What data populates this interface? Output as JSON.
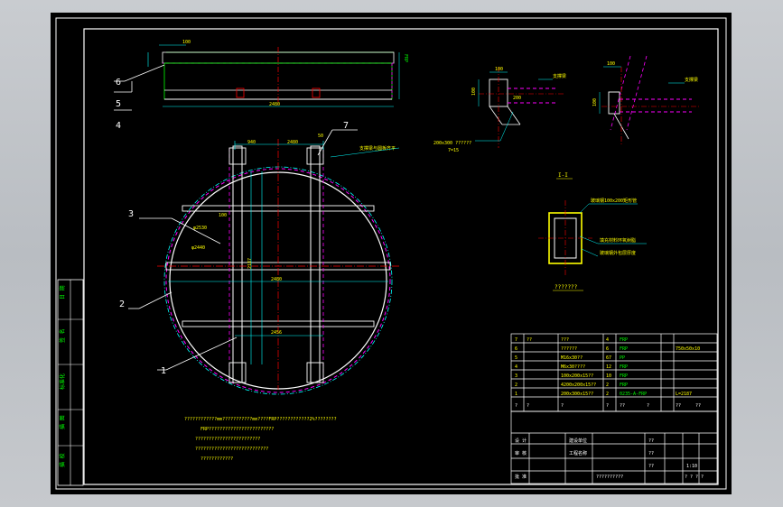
{
  "colors": {
    "background": "#000000",
    "frame": "#ffffff",
    "line": "#00ff00",
    "dim": "#00ffff",
    "hidden": "#ff00ff",
    "text_yellow": "#ffff00",
    "center": "#ff0000"
  },
  "top_view": {
    "dims": {
      "top": "100",
      "bottom": "2480"
    },
    "callouts": [
      "6",
      "5",
      "4"
    ]
  },
  "main_view": {
    "callouts": [
      "3",
      "2",
      "1",
      "7"
    ],
    "dims": {
      "top_a": "940",
      "top_b": "2480",
      "top_c": "50",
      "mid": "100",
      "center_v": "2187",
      "center_h": "2480",
      "lower": "2456"
    },
    "ring_labels": [
      "φ2530",
      "φ2440"
    ],
    "note_7": "支撑梁与圆板齐平"
  },
  "detail_a": {
    "label_main": "支撑梁",
    "dims": {
      "w": "100",
      "h": "100",
      "d": "200"
    },
    "note1": "200x300 ??????",
    "note2": "7=15"
  },
  "detail_b": {
    "label_main": "支撑梁",
    "dims": {
      "w": "100",
      "h": "100"
    }
  },
  "section": {
    "title": "I-I",
    "note_top": "玻璃钢100x200矩形管",
    "note_right1": "填充材料环氧树脂",
    "note_right2": "玻璃钢外包层厚度",
    "caption": "???????"
  },
  "notes": {
    "lines": [
      "????????????mm???????????mm????FRP????????????2%????????",
      "FRP????????????????????????",
      "????????????????????????",
      "???????????????????????????",
      "????????????"
    ]
  },
  "bom": {
    "rows": [
      {
        "no": "7",
        "code": "??",
        "name": "???",
        "qty": "4",
        "mat": "FRP",
        "note": ""
      },
      {
        "no": "6",
        "code": "",
        "name": "??????",
        "qty": "6",
        "mat": "FRP",
        "note": "750x50x10"
      },
      {
        "no": "5",
        "code": "",
        "name": "M16x30??",
        "qty": "67",
        "mat": "PP",
        "note": ""
      },
      {
        "no": "4",
        "code": "",
        "name": "M6x30????",
        "qty": "12",
        "mat": "FRP",
        "note": ""
      },
      {
        "no": "3",
        "code": "",
        "name": "100x200x15??",
        "qty": "10",
        "mat": "FRP",
        "note": ""
      },
      {
        "no": "2",
        "code": "",
        "name": "4200x200x15??",
        "qty": "2",
        "mat": "FRP",
        "note": ""
      },
      {
        "no": "1",
        "code": "",
        "name": "200x300x15??",
        "qty": "2",
        "mat": "0235-A-FRP",
        "note": "L=2187"
      }
    ],
    "header": [
      "?",
      "?",
      "?",
      "?",
      "??",
      "?",
      "??",
      "??"
    ]
  },
  "title_block": {
    "left_rows": [
      "设 计",
      "审 核",
      "批 准"
    ],
    "mid_rows": [
      "建设单位",
      "工程名称"
    ],
    "drawing_title": "??????????",
    "right_labels": [
      "??",
      "??",
      "??"
    ],
    "scale": "1:10",
    "sheet": "? ? ? ?"
  },
  "side_strip": [
    "日 期",
    "签 名",
    "标准化",
    "描 图",
    "描 校"
  ]
}
